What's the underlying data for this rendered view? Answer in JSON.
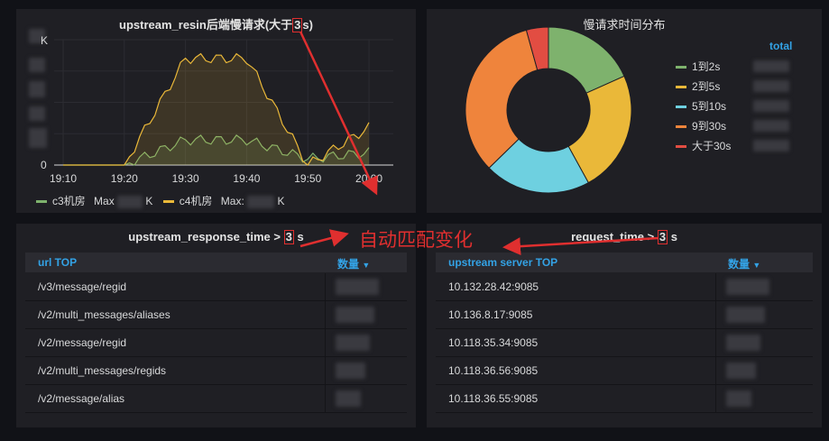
{
  "panels": {
    "resin_graph": {
      "title_prefix": "upstream_resin后端慢请求(大于",
      "title_threshold": "3",
      "title_suffix": "s)",
      "y_ticks": [
        "K",
        "0"
      ],
      "x_ticks": [
        "19:10",
        "19:20",
        "19:30",
        "19:40",
        "19:50",
        "20:00"
      ],
      "legend": [
        {
          "name": "c3机房",
          "label": "Max",
          "unit": "K",
          "color": "#7eb26d"
        },
        {
          "name": "c4机房",
          "label": "Max:",
          "unit": "K",
          "color": "#eab839"
        }
      ]
    },
    "pie": {
      "title": "慢请求时间分布",
      "total_label": "total",
      "legend": [
        {
          "label": "1到2s",
          "color": "#7eb26d",
          "share": 0.183
        },
        {
          "label": "2到5s",
          "color": "#eab839",
          "share": 0.237
        },
        {
          "label": "5到10s",
          "color": "#6ed0e0",
          "share": 0.207
        },
        {
          "label": "9到30s",
          "color": "#ef843c",
          "share": 0.33
        },
        {
          "label": "大于30s",
          "color": "#e24d42",
          "share": 0.043
        }
      ]
    },
    "url_table": {
      "title_prefix": "upstream_response_time >",
      "title_threshold": "3",
      "title_suffix": "s",
      "col_name": "url TOP",
      "col_count": "数量",
      "sort_icon": "caret-down-icon",
      "rows": [
        "/v3/message/regid",
        "/v2/multi_messages/aliases",
        "/v2/message/regid",
        "/v2/multi_messages/regids",
        "/v2/message/alias"
      ]
    },
    "server_table": {
      "title_prefix": "request_time >",
      "title_threshold": "3",
      "title_suffix": "s",
      "col_name": "upstream server TOP",
      "col_count": "数量",
      "sort_icon": "caret-down-icon",
      "rows": [
        "10.132.28.42:9085",
        "10.136.8.17:9085",
        "10.118.35.34:9085",
        "10.118.36.56:9085",
        "10.118.36.55:9085"
      ]
    }
  },
  "annotation": {
    "text": "自动匹配变化",
    "color": "#e02f2f"
  },
  "chart_data": {
    "type": "line",
    "title": "upstream_resin后端慢请求(大于3s)",
    "xlabel": "",
    "ylabel": "",
    "x": [
      "19:10",
      "19:20",
      "19:30",
      "19:40",
      "19:50",
      "20:00"
    ],
    "series": [
      {
        "name": "c3机房",
        "color": "#7eb26d",
        "values": [
          0,
          0,
          0.2,
          0.2,
          0.05,
          0.1
        ]
      },
      {
        "name": "c4机房",
        "color": "#eab839",
        "values": [
          0,
          0,
          0.85,
          0.85,
          0,
          0.3
        ]
      }
    ],
    "grid": true,
    "legend": "bottom-left"
  }
}
